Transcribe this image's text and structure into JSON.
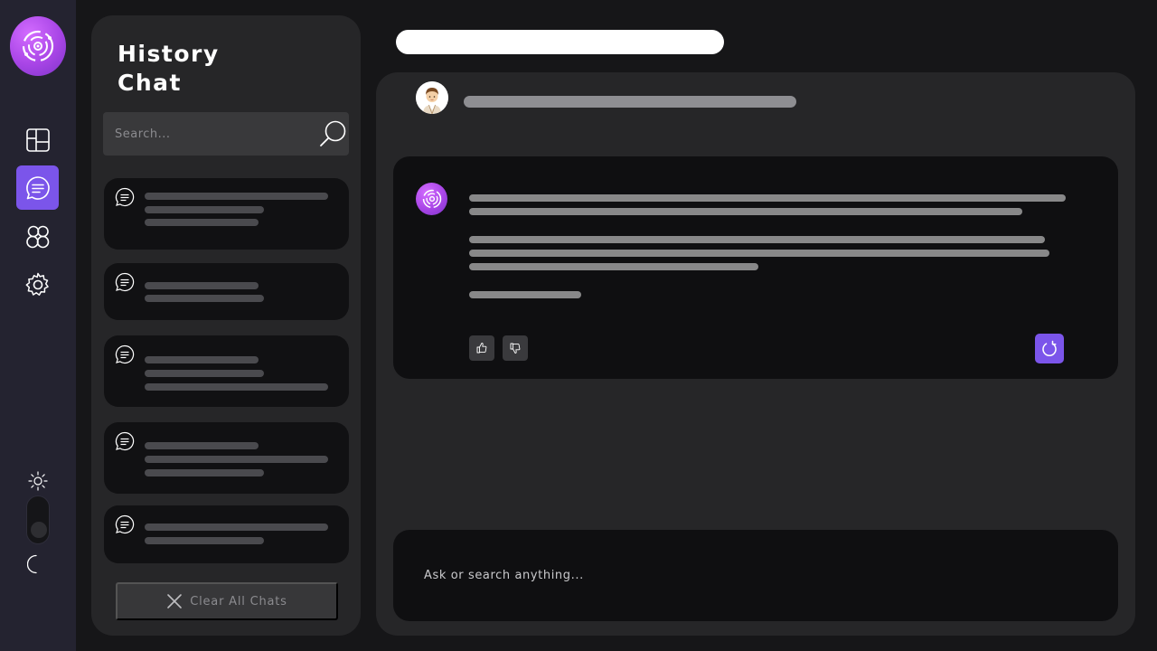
{
  "history": {
    "title": "History Chat",
    "search_placeholder": "Search...",
    "clear_label": "Clear All Chats",
    "chats": [
      {
        "lines": [
          203,
          132,
          126
        ]
      },
      {
        "lines": [
          126,
          132
        ]
      },
      {
        "lines": [
          126,
          132,
          203
        ]
      },
      {
        "lines": [
          126,
          203,
          132
        ]
      },
      {
        "lines": [
          203,
          132
        ]
      }
    ]
  },
  "composer": {
    "placeholder": "Ask or search anything..."
  },
  "colors": {
    "accent": "#7b55ea",
    "brand_gradient_start": "#d36cff",
    "brand_gradient_end": "#7d34c9",
    "background": "#161618",
    "panel": "#262628",
    "card": "#111113"
  },
  "icons": {
    "rail": [
      "dashboard-icon",
      "chat-icon",
      "community-icon",
      "settings-icon"
    ],
    "theme": [
      "sun-icon",
      "moon-icon"
    ]
  }
}
